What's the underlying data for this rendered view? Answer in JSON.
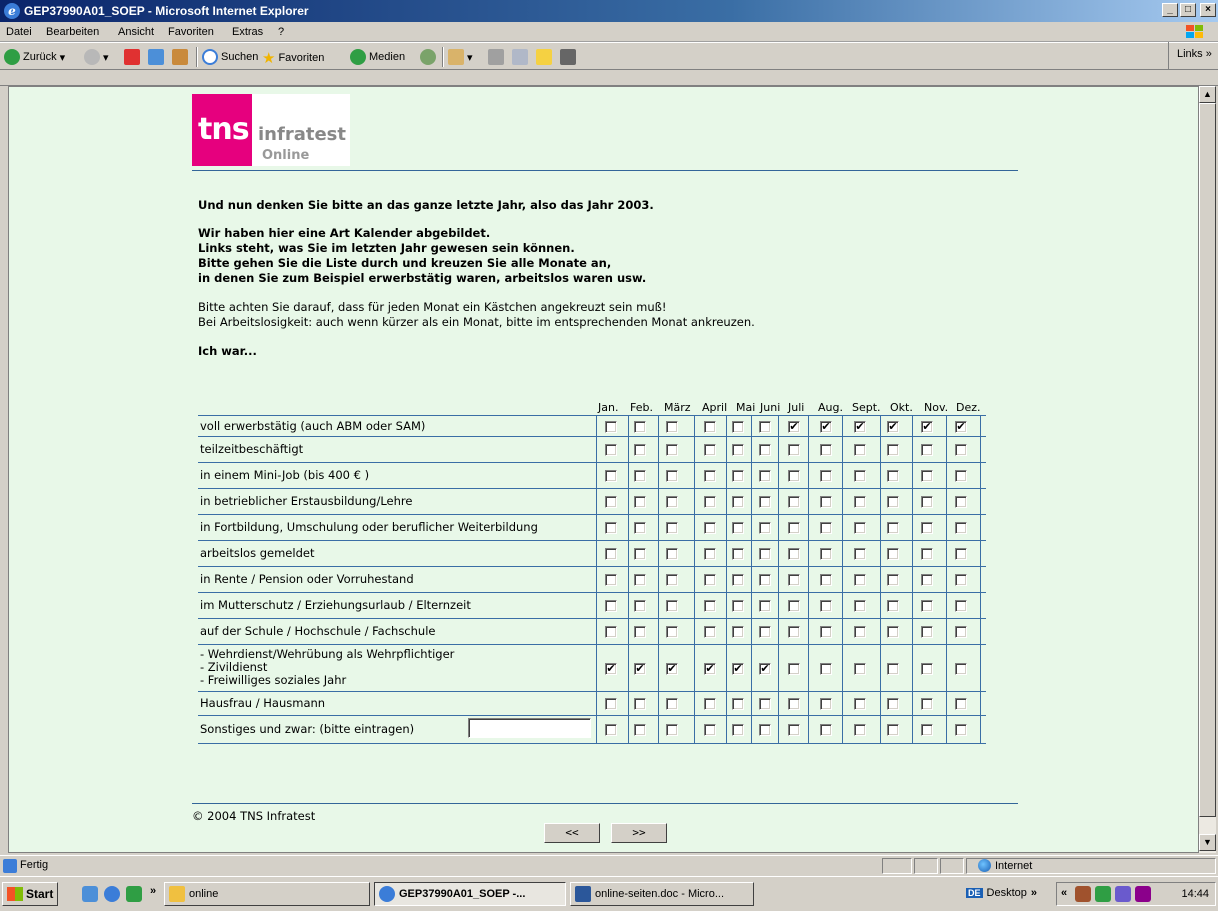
{
  "window": {
    "title": "GEP37990A01_SOEP - Microsoft Internet Explorer",
    "btn_min": "_",
    "btn_max": "□",
    "btn_close": "×"
  },
  "menu": [
    "Datei",
    "Bearbeiten",
    "Ansicht",
    "Favoriten",
    "Extras",
    "?"
  ],
  "toolbar": {
    "back": "Zurück",
    "search": "Suchen",
    "favorites": "Favoriten",
    "media": "Medien",
    "links": "Links"
  },
  "logo": {
    "brand": "tns",
    "name": "infratest",
    "sub": "Online"
  },
  "intro": {
    "line1": "Und nun denken Sie bitte an das ganze letzte Jahr, also das Jahr 2003.",
    "block2": [
      "Wir haben hier eine Art Kalender abgebildet.",
      "Links steht, was Sie im letzten Jahr gewesen sein können.",
      "Bitte gehen Sie die Liste durch und kreuzen Sie alle Monate an,",
      "in denen Sie zum Beispiel erwerbstätig waren, arbeitslos waren usw."
    ],
    "block3": [
      "Bitte achten Sie darauf, dass für jeden Monat ein Kästchen angekreuzt sein muß!",
      "Bei Arbeitslosigkeit: auch wenn kürzer als ein Monat, bitte im entsprechenden Monat ankreuzen."
    ],
    "prompt": "Ich war..."
  },
  "calendar": {
    "months": [
      "Jan.",
      "Feb.",
      "März",
      "April",
      "Mai",
      "Juni",
      "Juli",
      "Aug.",
      "Sept.",
      "Okt.",
      "Nov.",
      "Dez."
    ],
    "rows": [
      {
        "label": "voll erwerbstätig (auch ABM oder SAM)",
        "checked": [
          0,
          0,
          0,
          0,
          0,
          0,
          1,
          1,
          1,
          1,
          1,
          1
        ]
      },
      {
        "label": "teilzeitbeschäftigt",
        "checked": [
          0,
          0,
          0,
          0,
          0,
          0,
          0,
          0,
          0,
          0,
          0,
          0
        ]
      },
      {
        "label": "in einem Mini-Job (bis 400 € )",
        "checked": [
          0,
          0,
          0,
          0,
          0,
          0,
          0,
          0,
          0,
          0,
          0,
          0
        ]
      },
      {
        "label": "in betrieblicher Erstausbildung/Lehre",
        "checked": [
          0,
          0,
          0,
          0,
          0,
          0,
          0,
          0,
          0,
          0,
          0,
          0
        ]
      },
      {
        "label": "in Fortbildung, Umschulung oder beruflicher Weiterbildung",
        "checked": [
          0,
          0,
          0,
          0,
          0,
          0,
          0,
          0,
          0,
          0,
          0,
          0
        ]
      },
      {
        "label": "arbeitslos gemeldet",
        "checked": [
          0,
          0,
          0,
          0,
          0,
          0,
          0,
          0,
          0,
          0,
          0,
          0
        ]
      },
      {
        "label": "in Rente / Pension oder Vorruhestand",
        "checked": [
          0,
          0,
          0,
          0,
          0,
          0,
          0,
          0,
          0,
          0,
          0,
          0
        ]
      },
      {
        "label": "im Mutterschutz / Erziehungsurlaub / Elternzeit",
        "checked": [
          0,
          0,
          0,
          0,
          0,
          0,
          0,
          0,
          0,
          0,
          0,
          0
        ]
      },
      {
        "label": "auf der Schule / Hochschule / Fachschule",
        "checked": [
          0,
          0,
          0,
          0,
          0,
          0,
          0,
          0,
          0,
          0,
          0,
          0
        ]
      },
      {
        "label": "- Wehrdienst/Wehrübung als Wehrpflichtiger\n- Zivildienst\n- Freiwilliges soziales Jahr",
        "checked": [
          1,
          1,
          1,
          1,
          1,
          1,
          0,
          0,
          0,
          0,
          0,
          0
        ]
      },
      {
        "label": "Hausfrau / Hausmann",
        "checked": [
          0,
          0,
          0,
          0,
          0,
          0,
          0,
          0,
          0,
          0,
          0,
          0
        ]
      },
      {
        "label": "Sonstiges und zwar: (bitte eintragen)",
        "checked": [
          0,
          0,
          0,
          0,
          0,
          0,
          0,
          0,
          0,
          0,
          0,
          0
        ],
        "has_input": true,
        "input_value": ""
      }
    ],
    "check_mark": "✔"
  },
  "footer": {
    "copyright": "© 2004 TNS Infratest",
    "prev": "<<",
    "next": ">>"
  },
  "status": {
    "text": "Fertig",
    "zone": "Internet"
  },
  "taskbar": {
    "start": "Start",
    "chevron": "»",
    "folder": "online",
    "ie_task": "GEP37990A01_SOEP -...",
    "word_task": "online-seiten.doc - Micro...",
    "desktop": "Desktop",
    "clock": "14:44"
  }
}
